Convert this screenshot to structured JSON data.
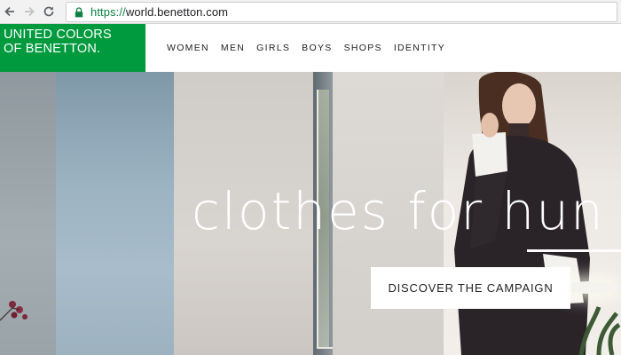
{
  "browser": {
    "url_scheme": "https://",
    "url_host": "world.benetton.com",
    "back_icon": "back-arrow-icon",
    "forward_icon": "forward-arrow-icon",
    "reload_icon": "reload-icon",
    "secure_icon": "lock-icon",
    "secure_color": "#0b8043"
  },
  "header": {
    "logo_line1": "UNITED COLORS",
    "logo_line2": "OF BENETTON.",
    "logo_color": "#009a3e",
    "nav": [
      "WOMEN",
      "MEN",
      "GIRLS",
      "BOYS",
      "SHOPS",
      "IDENTITY"
    ]
  },
  "hero": {
    "headline": "clothes for hun",
    "cta_label": "DISCOVER THE CAMPAIGN"
  }
}
